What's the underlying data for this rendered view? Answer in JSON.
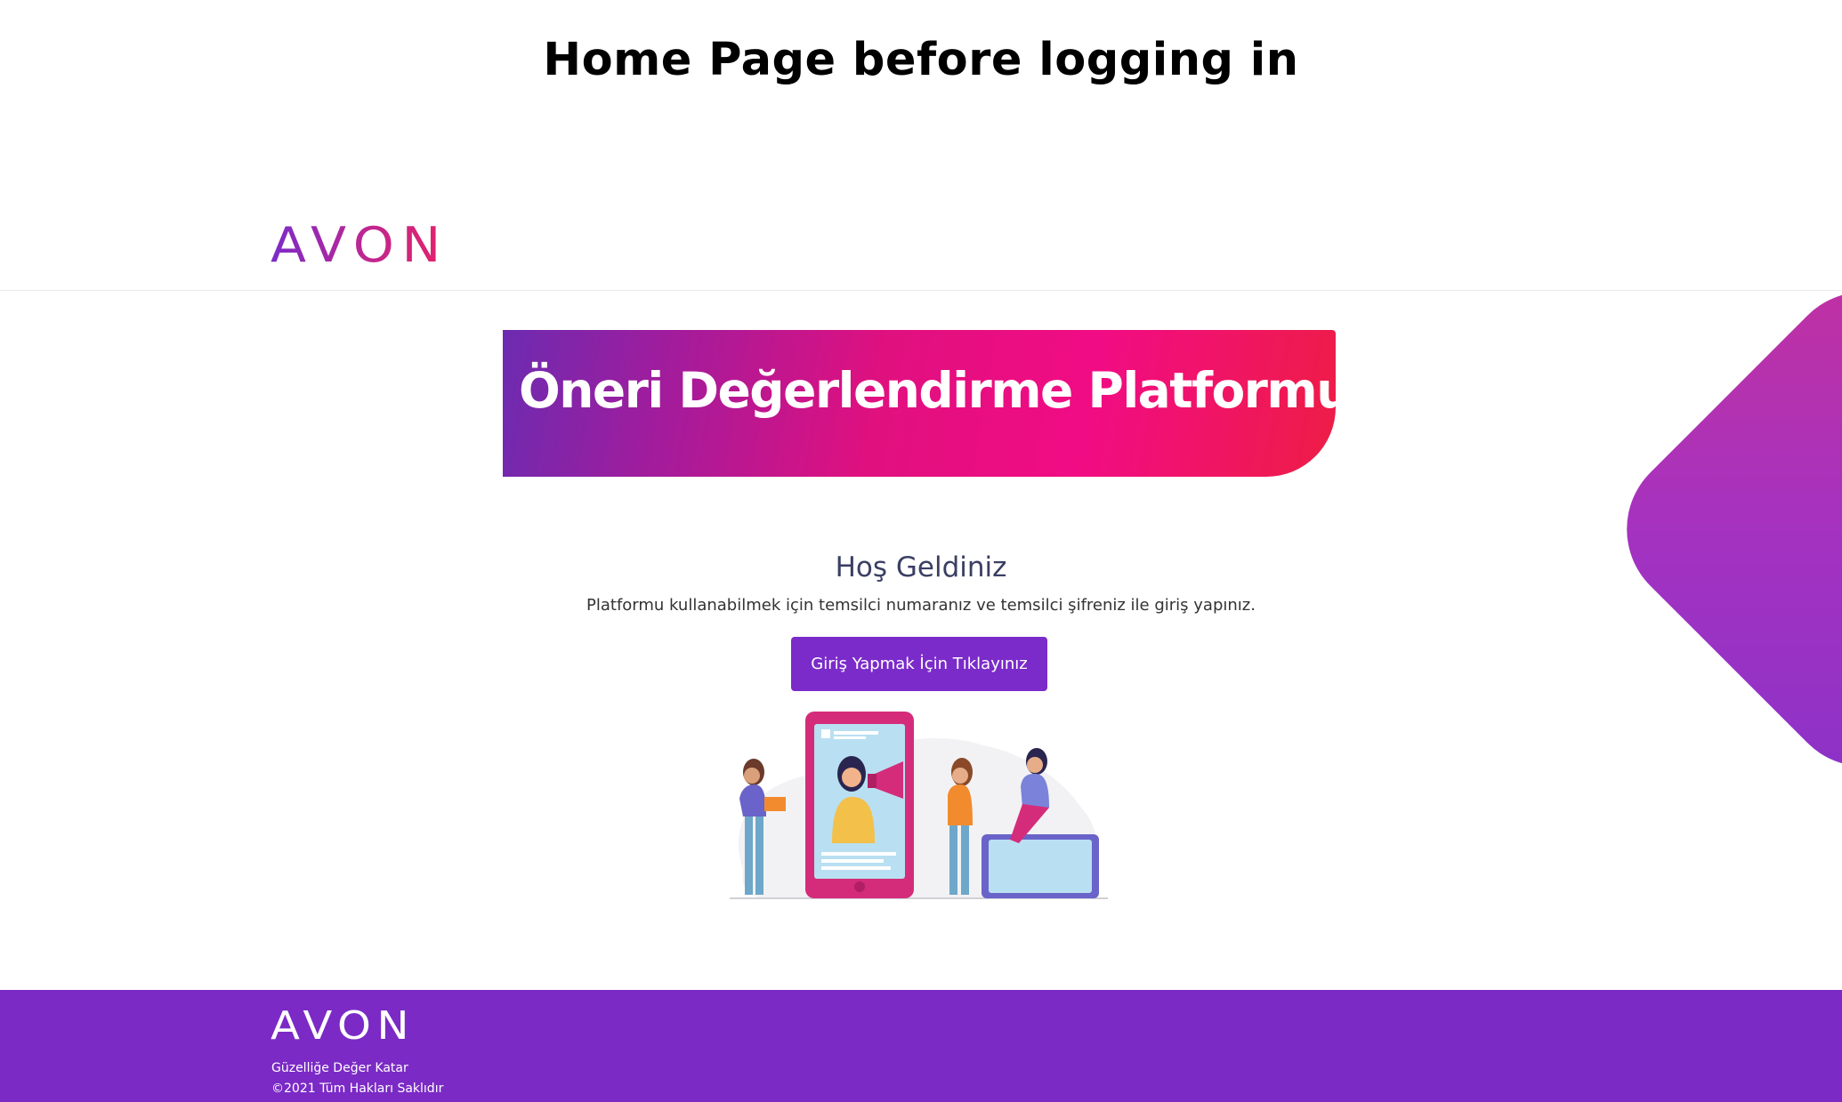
{
  "caption": "Home Page before logging in",
  "header": {
    "logo_text": "AVON"
  },
  "banner": {
    "title": "Öneri Değerlendirme Platformu"
  },
  "welcome": {
    "title": "Hoş Geldiniz",
    "subtitle": "Platformu kullanabilmek için temsilci numaranız ve temsilci şifreniz ile giriş yapınız.",
    "login_button_label": "Giriş Yapmak İçin Tıklayınız"
  },
  "footer": {
    "logo_text": "AVON",
    "tagline": "Güzelliğe Değer Katar",
    "copyright": "©2021 Tüm Hakları Saklıdır"
  },
  "colors": {
    "brand_purple": "#7b2ac6",
    "brand_pink": "#e0107f",
    "button": "#7b2bc9",
    "title_text": "#3a3f63"
  },
  "icons": {
    "illustration": "megaphone-team-illustration"
  }
}
